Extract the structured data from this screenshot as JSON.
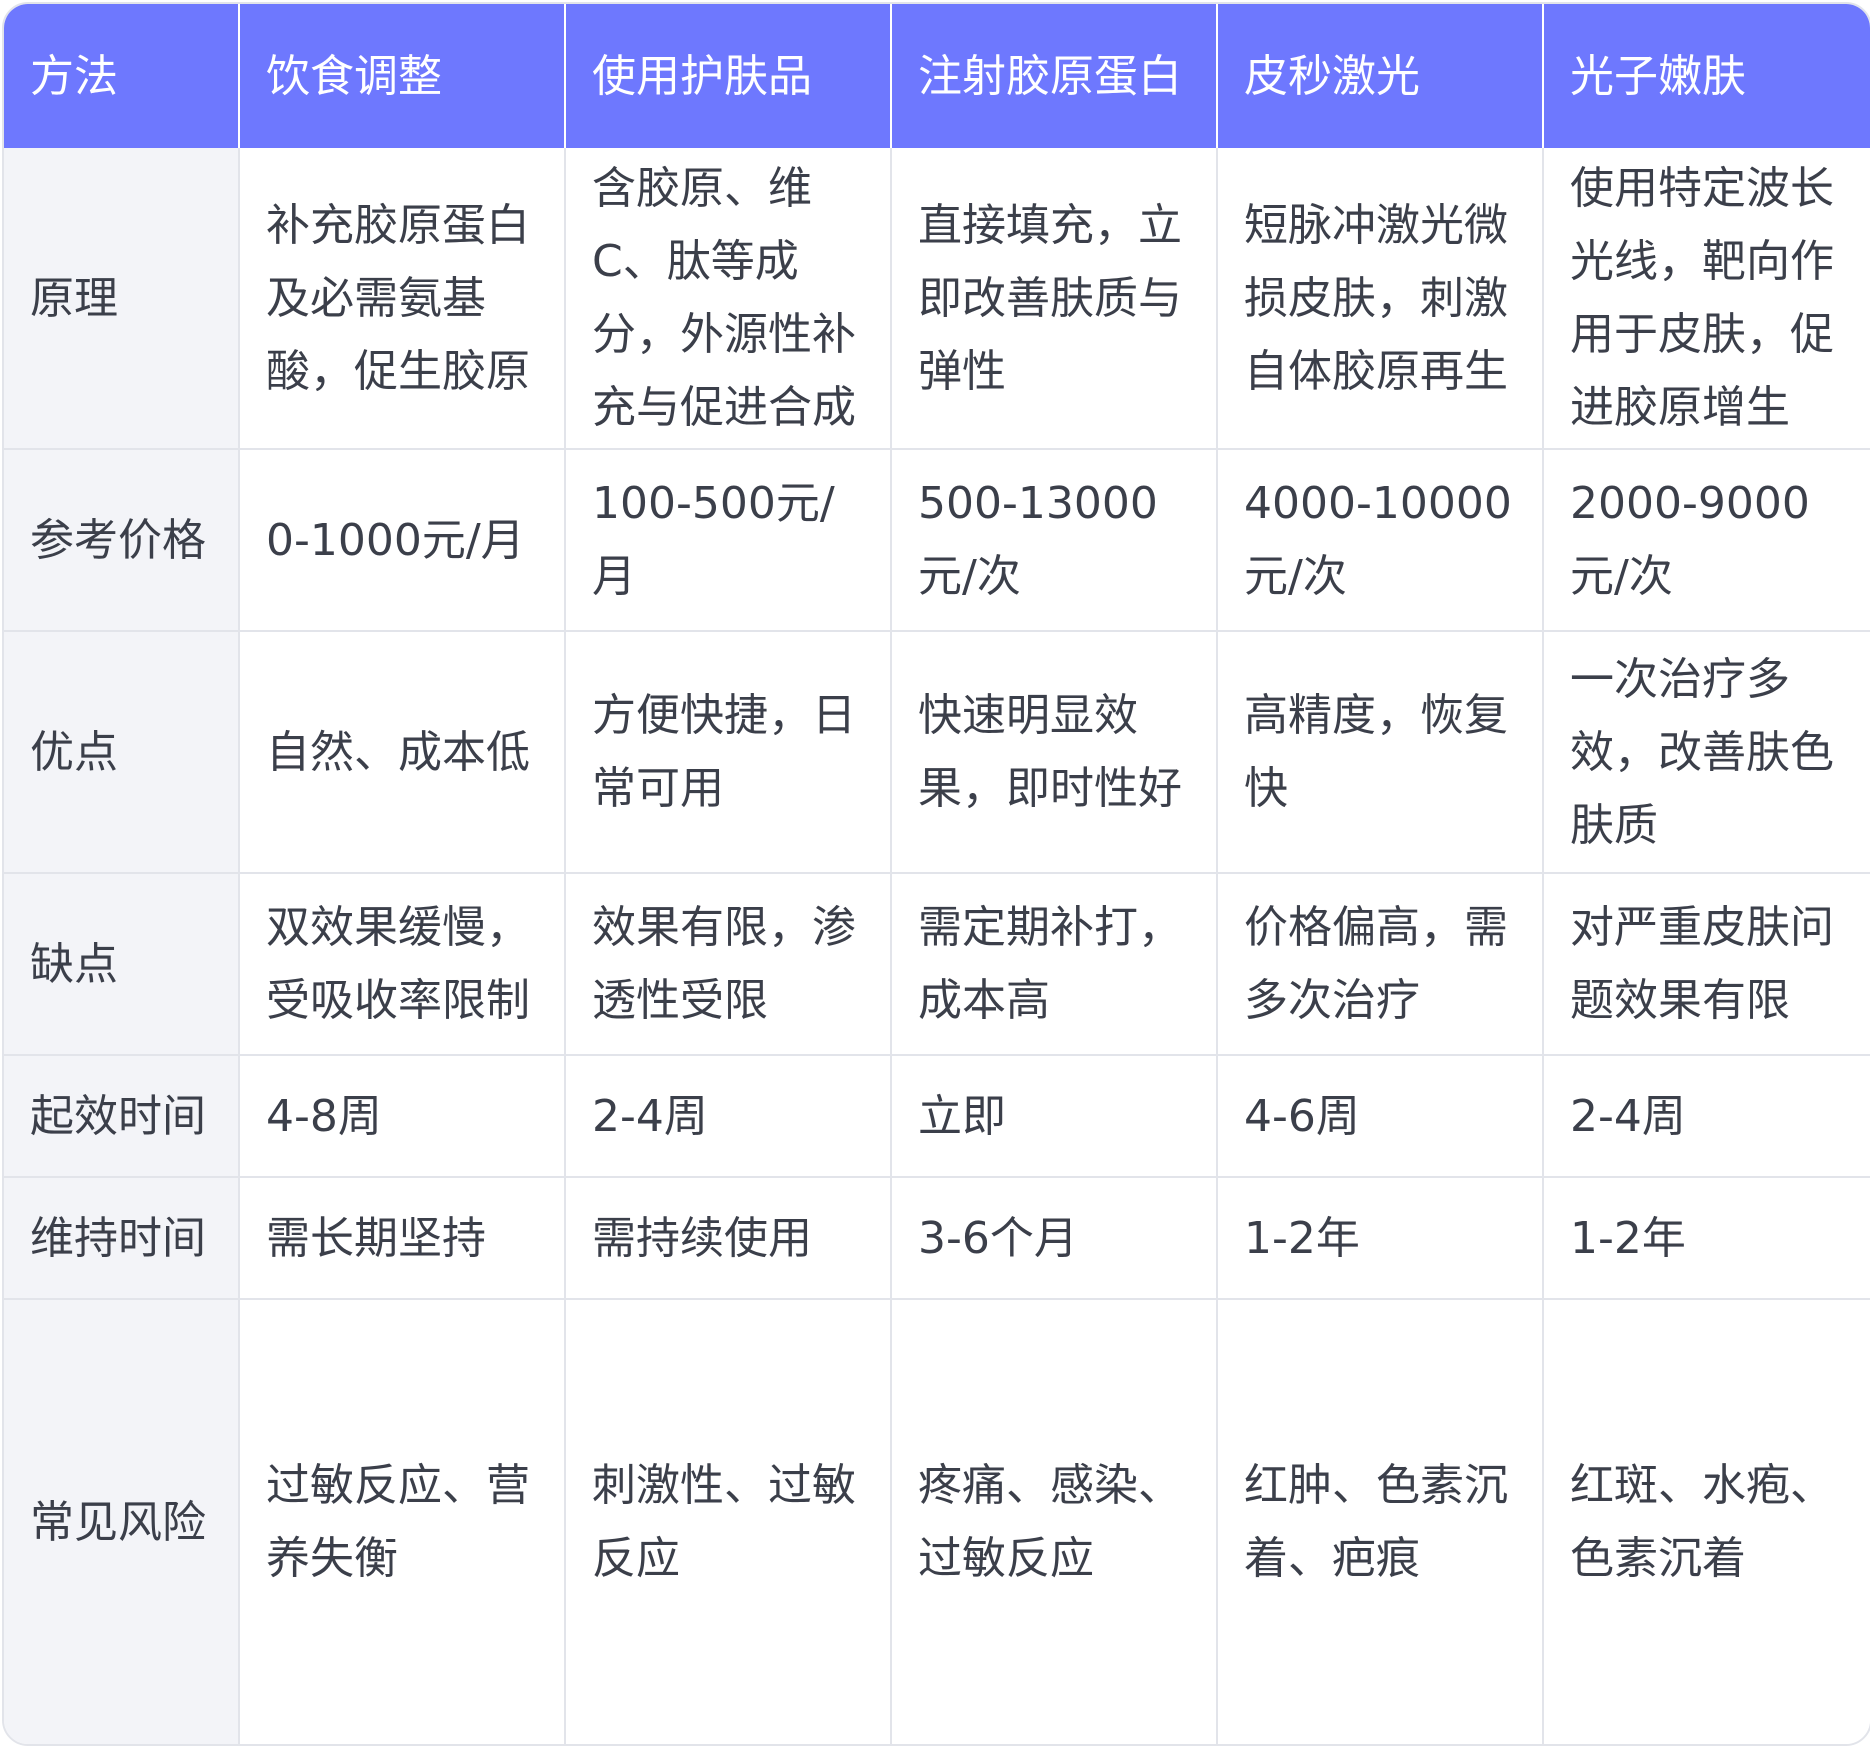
{
  "table": {
    "headers": [
      "方法",
      "饮食调整",
      "使用护肤品",
      "注射胶原蛋白",
      "皮秒激光",
      "光子嫩肤"
    ],
    "rows": [
      {
        "label": "原理",
        "cells": [
          "补充胶原蛋白及必需氨基酸，促生胶原",
          "含胶原、维C、肽等成分，外源性补充与促进合成",
          "直接填充，立即改善肤质与弹性",
          "短脉冲激光微损皮肤，刺激自体胶原再生",
          "使用特定波长光线，靶向作用于皮肤，促进胶原增生"
        ]
      },
      {
        "label": "参考价格",
        "cells": [
          "0-1000元/月",
          "100-500元/月",
          "500-13000元/次",
          "4000-10000元/次",
          "2000-9000元/次"
        ]
      },
      {
        "label": "优点",
        "cells": [
          "自然、成本低",
          "方便快捷，日常可用",
          "快速明显效果，即时性好",
          "高精度，恢复快",
          "一次治疗多效，改善肤色肤质"
        ]
      },
      {
        "label": "缺点",
        "cells": [
          "双效果缓慢，受吸收率限制",
          "效果有限，渗透性受限",
          "需定期补打，成本高",
          "价格偏高，需多次治疗",
          "对严重皮肤问题效果有限"
        ]
      },
      {
        "label": "起效时间",
        "cells": [
          "4-8周",
          "2-4周",
          "立即",
          "4-6周",
          "2-4周"
        ]
      },
      {
        "label": "维持时间",
        "cells": [
          "需长期坚持",
          "需持续使用",
          "3-6个月",
          "1-2年",
          "1-2年"
        ]
      },
      {
        "label": "常见风险",
        "cells": [
          "过敏反应、营养失衡",
          "刺激性、过敏反应",
          "疼痛、感染、过敏反应",
          "红肿、色素沉着、疤痕",
          "红斑、水疱、色素沉着"
        ]
      }
    ]
  },
  "colors": {
    "header_bg": "#6e78fe",
    "header_text": "#ffffff",
    "rowhead_bg": "#f3f4f8",
    "border": "#e2e4ea",
    "text": "#3b3f4a"
  }
}
